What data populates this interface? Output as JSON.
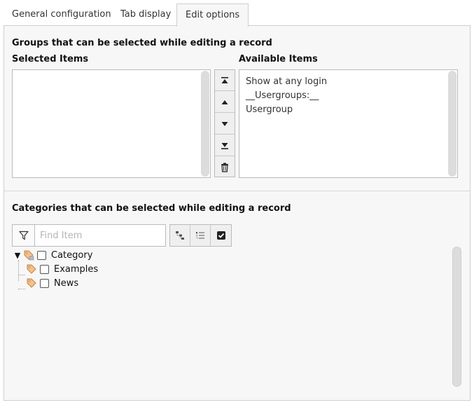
{
  "tabs": [
    {
      "label": "General configuration"
    },
    {
      "label": "Tab display"
    },
    {
      "label": "Edit options",
      "active": true
    }
  ],
  "groups_section": {
    "heading": "Groups that can be selected while editing a record",
    "selected_heading": "Selected Items",
    "available_heading": "Available Items",
    "selected_items": [],
    "available_items": [
      "Show at any login",
      "__Usergroups:__",
      "Usergroup"
    ],
    "buttons": [
      "move-to-top-icon",
      "move-up-icon",
      "move-down-icon",
      "move-to-bottom-icon",
      "trash-icon"
    ]
  },
  "categories_section": {
    "heading": "Categories that can be selected while editing a record",
    "search_placeholder": "Find Item",
    "tree": [
      {
        "label": "Category",
        "expanded": true,
        "checked": false
      },
      {
        "label": "Examples",
        "checked": false
      },
      {
        "label": "News",
        "checked": false
      }
    ]
  },
  "colors": {
    "panel_bg": "#f7f7f7",
    "border": "#bbbbbb",
    "tag_icon": "#e3a35b"
  }
}
